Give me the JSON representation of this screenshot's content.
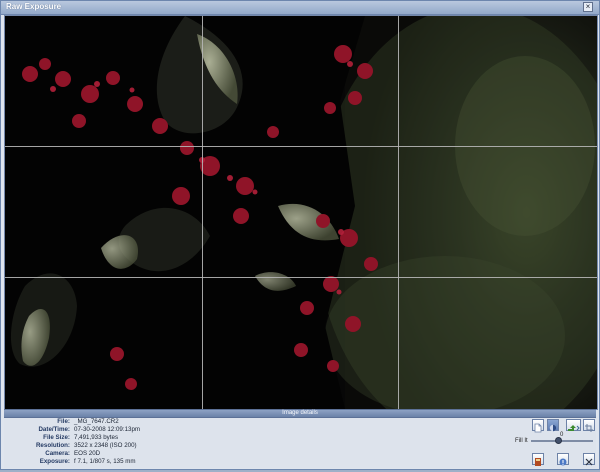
{
  "window": {
    "title": "Raw Exposure",
    "close_icon": "close-icon"
  },
  "panel": {
    "title": "Image details"
  },
  "details": [
    {
      "key": "File:",
      "value": "_MG_7647.CR2"
    },
    {
      "key": "Date/Time:",
      "value": "07-30-2008 12:09:13pm"
    },
    {
      "key": "File Size:",
      "value": "7,491,933 bytes"
    },
    {
      "key": "Resolution:",
      "value": "3522 x 2348 (ISO 200)"
    },
    {
      "key": "Camera:",
      "value": "EOS 20D"
    },
    {
      "key": "Exposure:",
      "value": "f 7.1, 1/807 s, 135 mm"
    }
  ],
  "controls": {
    "fill_label": "Fill It",
    "fill_value": "0",
    "fill_fraction": 0.45
  },
  "icons": {
    "tools": [
      "document-icon",
      "contrast-icon",
      "export-icon",
      "crop-icon",
      "save-icon",
      "help-icon",
      "cancel-icon"
    ]
  },
  "colors": {
    "title_text": "#ffffff",
    "label_text": "#243a63",
    "window_bg": "#dfe5ee"
  }
}
